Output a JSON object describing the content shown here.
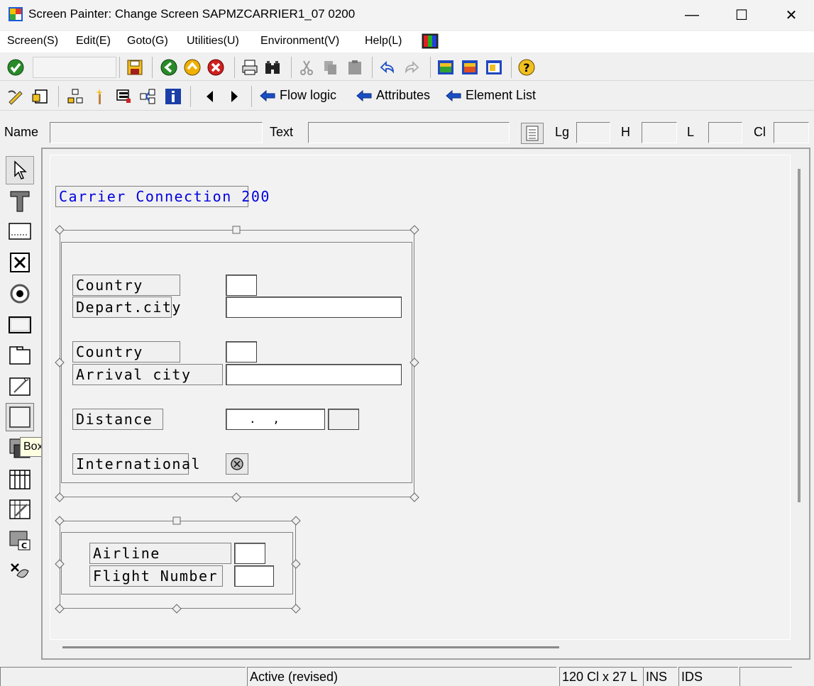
{
  "window": {
    "title": "Screen Painter:  Change Screen SAPMZCARRIER1_07 0200",
    "minimize": "—",
    "maximize": "☐",
    "close": "✕"
  },
  "menu": [
    "Screen(S)",
    "Edit(E)",
    "Goto(G)",
    "Utilities(U)",
    "Environment(V)",
    "Help(L)"
  ],
  "nav_links": {
    "flow_logic": "Flow logic",
    "attributes": "Attributes",
    "element_list": "Element List"
  },
  "attr_row": {
    "name_label": "Name",
    "text_label": "Text",
    "lg_label": "Lg",
    "h_label": "H",
    "l_label": "L",
    "cl_label": "Cl"
  },
  "tooltip": "Box",
  "screen": {
    "title": "Carrier Connection 200",
    "country1": "Country",
    "depart_city": "Depart.city",
    "country2": "Country",
    "arrival_city": "Arrival city",
    "distance": "Distance",
    "distance_mask": ".  ,",
    "international": "International",
    "airline": "Airline",
    "flight_number": "Flight Number"
  },
  "status": {
    "state": "Active (revised)",
    "size": "120 Cl x 27 L",
    "mode": "INS",
    "ids": "IDS"
  },
  "colors": {
    "screen_title": "#0000e0",
    "arrow_blue": "#1a4fc4"
  }
}
